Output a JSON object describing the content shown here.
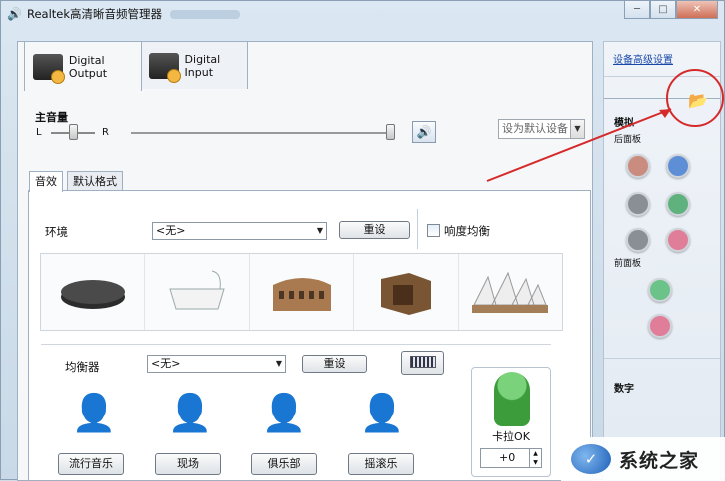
{
  "window": {
    "title": "Realtek高清晰音频管理器"
  },
  "device_tabs": [
    {
      "label": "Digital Output",
      "active": true
    },
    {
      "label": "Digital Input",
      "active": false
    }
  ],
  "volume": {
    "label": "主音量",
    "left": "L",
    "right": "R",
    "set_default": "设为默认设备",
    "master_level": 0.95,
    "balance": 0.5
  },
  "tabs": [
    {
      "label": "音效"
    },
    {
      "label": "默认格式"
    }
  ],
  "effects": {
    "env_label": "环境",
    "env_value": "<无>",
    "reset": "重设",
    "loudness": "响度均衡",
    "env_icons": [
      "stone-disc",
      "bathtub",
      "colosseum",
      "box-room",
      "opera-house"
    ]
  },
  "eq": {
    "label": "均衡器",
    "value": "<无>",
    "reset": "重设",
    "presets": [
      "流行音乐",
      "现场",
      "俱乐部",
      "摇滚乐"
    ]
  },
  "karaoke": {
    "label": "卡拉OK",
    "value": "+0"
  },
  "side": {
    "advanced": "设备高级设置",
    "analog": "模拟",
    "back": "后面板",
    "front": "前面板",
    "digital": "数字",
    "back_colors": [
      "#c98c7e",
      "#5e8fd6",
      "#8a8f95",
      "#5fb27e",
      "#8a8f95",
      "#e07e9a"
    ],
    "front_colors": [
      "#6cc38a",
      "#e07e9a"
    ]
  },
  "watermark": {
    "text": "系统之家"
  }
}
